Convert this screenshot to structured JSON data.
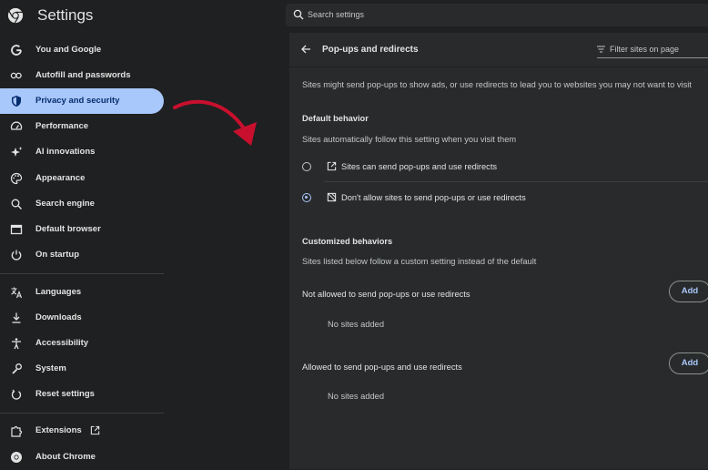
{
  "app": {
    "title": "Settings",
    "logo_icon": "chrome-logo-icon"
  },
  "search": {
    "placeholder": "Search settings"
  },
  "sidebar": {
    "items": [
      {
        "label": "You and Google",
        "icon": "google-icon"
      },
      {
        "label": "Autofill and passwords",
        "icon": "key-icon"
      },
      {
        "label": "Privacy and security",
        "icon": "shield-icon",
        "active": true
      },
      {
        "label": "Performance",
        "icon": "speedometer-icon"
      },
      {
        "label": "AI innovations",
        "icon": "sparkle-icon"
      },
      {
        "label": "Appearance",
        "icon": "palette-icon"
      },
      {
        "label": "Search engine",
        "icon": "search-icon"
      },
      {
        "label": "Default browser",
        "icon": "browser-icon"
      },
      {
        "label": "On startup",
        "icon": "power-icon"
      },
      {
        "label": "Languages",
        "icon": "translate-icon"
      },
      {
        "label": "Downloads",
        "icon": "download-icon"
      },
      {
        "label": "Accessibility",
        "icon": "accessibility-icon"
      },
      {
        "label": "System",
        "icon": "wrench-icon"
      },
      {
        "label": "Reset settings",
        "icon": "reset-icon"
      },
      {
        "label": "Extensions",
        "icon": "puzzle-icon"
      },
      {
        "label": "About Chrome",
        "icon": "chrome-icon"
      }
    ]
  },
  "main": {
    "title": "Pop-ups and redirects",
    "filter_placeholder": "Filter sites on page",
    "intro": "Sites might send pop-ups to show ads, or use redirects to lead you to websites you may not want to visit",
    "default_behavior": {
      "heading": "Default behavior",
      "subtext": "Sites automatically follow this setting when you visit them",
      "options": [
        {
          "label": "Sites can send pop-ups and use redirects",
          "selected": false,
          "icon": "open-in-new-icon"
        },
        {
          "label": "Don't allow sites to send pop-ups or use redirects",
          "selected": true,
          "icon": "popup-blocked-icon"
        }
      ]
    },
    "customized": {
      "heading": "Customized behaviors",
      "subtext": "Sites listed below follow a custom setting instead of the default",
      "sections": [
        {
          "label": "Not allowed to send pop-ups or use redirects",
          "button": "Add",
          "empty": "No sites added"
        },
        {
          "label": "Allowed to send pop-ups and use redirects",
          "button": "Add",
          "empty": "No sites added"
        }
      ]
    }
  },
  "colors": {
    "accent": "#a8c7fa",
    "annotation_arrow": "#c8102e",
    "background": "#1f2021",
    "panel": "#282a2c"
  }
}
